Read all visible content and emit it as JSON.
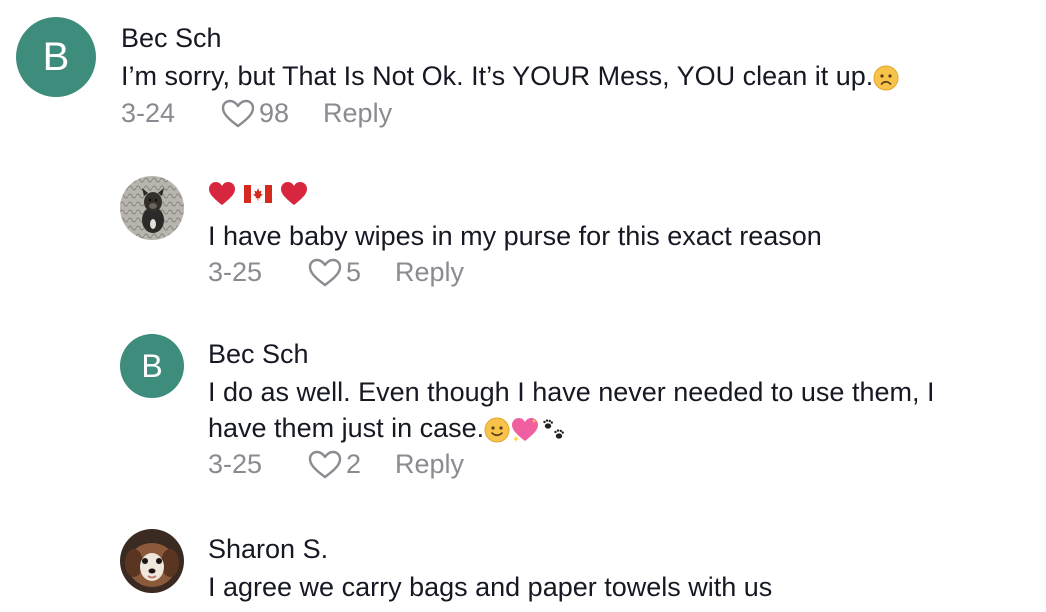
{
  "comments": [
    {
      "username": "Bec Sch",
      "avatar_letter": "B",
      "text": "I’m sorry, but That Is Not Ok. It’s YOUR Mess, YOU clean it up.",
      "emoji": "frowning-face",
      "date": "3-24",
      "likes": "98",
      "reply_label": "Reply"
    },
    {
      "username_emojis": [
        "red-heart",
        "canada-flag",
        "red-heart"
      ],
      "avatar": "dog-photo",
      "text": "I have baby wipes in my purse for this exact reason",
      "date": "3-25",
      "likes": "5",
      "reply_label": "Reply"
    },
    {
      "username": "Bec Sch",
      "avatar_letter": "B",
      "text_line1": "I do as well. Even though I have never needed to use them, I",
      "text_line2": "have them just in case.",
      "emojis": [
        "slightly-smiling-face",
        "sparkling-heart",
        "paw-prints"
      ],
      "date": "3-25",
      "likes": "2",
      "reply_label": "Reply"
    },
    {
      "username": "Sharon S.",
      "avatar": "puppy-photo",
      "text": "I agree we carry bags and paper towels with us"
    }
  ],
  "colors": {
    "avatar_bg": "#3e8d7c",
    "text": "#161823",
    "meta": "#8a8b91"
  }
}
